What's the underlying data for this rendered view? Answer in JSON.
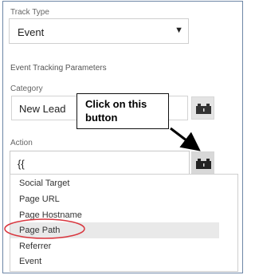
{
  "track_type": {
    "label": "Track Type",
    "value": "Event",
    "caret": "▼"
  },
  "section_title": "Event Tracking Parameters",
  "category": {
    "label": "Category",
    "value": "New Lead",
    "variable_button_icon": "brick-icon"
  },
  "action": {
    "label": "Action",
    "value": "{{",
    "variable_button_icon": "brick-icon"
  },
  "dropdown": {
    "items": [
      {
        "label": "Social Target"
      },
      {
        "label": "Page URL"
      },
      {
        "label": "Page Hostname"
      },
      {
        "label": "Page Path",
        "highlighted": true
      },
      {
        "label": "Referrer"
      },
      {
        "label": "Event"
      }
    ]
  },
  "annotation": {
    "callout_line1": "Click on this",
    "callout_line2": "button",
    "arrow_color": "#000000",
    "circle_color": "#d9363e"
  },
  "colors": {
    "frame_border": "#6d86a6",
    "button_bg": "#e4e4e4",
    "hover_bg": "#e9e9e9"
  }
}
